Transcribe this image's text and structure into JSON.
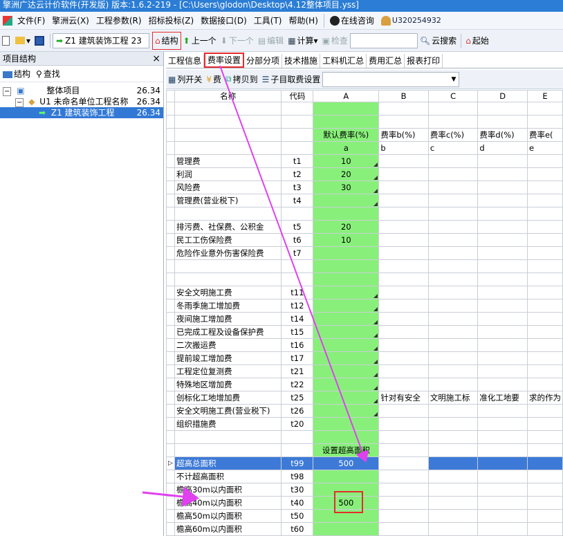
{
  "window": {
    "title": "擎洲广达云计价软件(开发版) 版本:1.6.2-219 - [C:\\Users\\glodon\\Desktop\\4.12整体项目.yss]"
  },
  "menu": [
    "文件(F)",
    "擎洲云(X)",
    "工程参数(R)",
    "招标投标(Z)",
    "数据接口(D)",
    "工具(T)",
    "帮助(H)",
    "在线咨询",
    "U320254932"
  ],
  "toolbar": {
    "project_combo": "Z1  建筑装饰工程 23",
    "structure": "结构",
    "prev": "上一个",
    "next": "下一个",
    "edit": "编辑",
    "calc": "计算",
    "check": "检查",
    "search_value": "",
    "cloud_search": "云搜索",
    "start": "起始"
  },
  "left_pane": {
    "title": "项目结构",
    "close": "×",
    "btn_structure": "结构",
    "btn_find": "查找",
    "tree": [
      {
        "label": "整体项目",
        "value": "26.34"
      },
      {
        "label": "U1   未命名单位工程名称",
        "value": "26.34"
      },
      {
        "label": "Z1   建筑装饰工程",
        "value": "26.34"
      }
    ]
  },
  "tabs": [
    "工程信息",
    "费率设置",
    "分部分项",
    "技术措施",
    "工料机汇总",
    "费用汇总",
    "报表打印"
  ],
  "sub_toolbar": {
    "col_toggle": "列开关",
    "fee": "费",
    "copy_to": "拷贝到",
    "sub_item_fee": "子目取费设置",
    "combo_value": ""
  },
  "grid": {
    "headers": [
      "名称",
      "代码",
      "A",
      "B",
      "C",
      "D",
      "E"
    ],
    "rows": [
      {
        "name": "",
        "code": "",
        "a": "",
        "b": "",
        "c": "",
        "d": "",
        "e": ""
      },
      {
        "name": "",
        "code": "",
        "a": "",
        "b": "",
        "c": "",
        "d": "",
        "e": ""
      },
      {
        "name": "",
        "code": "",
        "a": "默认费率(%)",
        "b": "费率b(%)",
        "c": "费率c(%)",
        "d": "费率d(%)",
        "e": "费率e("
      },
      {
        "name": "",
        "code": "",
        "a": "a",
        "b": "b",
        "c": "c",
        "d": "d",
        "e": "e"
      },
      {
        "name": "管理费",
        "code": "t1",
        "a": "10",
        "b": "",
        "c": "",
        "d": "",
        "e": ""
      },
      {
        "name": "利润",
        "code": "t2",
        "a": "20",
        "b": "",
        "c": "",
        "d": "",
        "e": ""
      },
      {
        "name": "风险费",
        "code": "t3",
        "a": "30",
        "b": "",
        "c": "",
        "d": "",
        "e": ""
      },
      {
        "name": "管理费(营业税下)",
        "code": "t4",
        "a": "",
        "b": "",
        "c": "",
        "d": "",
        "e": ""
      },
      {
        "name": "",
        "code": "",
        "a": "",
        "b": "",
        "c": "",
        "d": "",
        "e": ""
      },
      {
        "name": "排污费、社保费、公积金",
        "code": "t5",
        "a": "20",
        "b": "",
        "c": "",
        "d": "",
        "e": ""
      },
      {
        "name": "民工工伤保险费",
        "code": "t6",
        "a": "10",
        "b": "",
        "c": "",
        "d": "",
        "e": ""
      },
      {
        "name": "危险作业意外伤害保险费",
        "code": "t7",
        "a": "",
        "b": "",
        "c": "",
        "d": "",
        "e": ""
      },
      {
        "name": "",
        "code": "",
        "a": "",
        "b": "",
        "c": "",
        "d": "",
        "e": ""
      },
      {
        "name": "",
        "code": "",
        "a": "",
        "b": "",
        "c": "",
        "d": "",
        "e": ""
      },
      {
        "name": "安全文明施工费",
        "code": "t11",
        "a": "",
        "b": "",
        "c": "",
        "d": "",
        "e": ""
      },
      {
        "name": "冬雨季施工增加费",
        "code": "t12",
        "a": "",
        "b": "",
        "c": "",
        "d": "",
        "e": ""
      },
      {
        "name": "夜间施工增加费",
        "code": "t14",
        "a": "",
        "b": "",
        "c": "",
        "d": "",
        "e": ""
      },
      {
        "name": "已完成工程及设备保护费",
        "code": "t15",
        "a": "",
        "b": "",
        "c": "",
        "d": "",
        "e": ""
      },
      {
        "name": "二次搬运费",
        "code": "t16",
        "a": "",
        "b": "",
        "c": "",
        "d": "",
        "e": ""
      },
      {
        "name": "提前竣工增加费",
        "code": "t17",
        "a": "",
        "b": "",
        "c": "",
        "d": "",
        "e": ""
      },
      {
        "name": "工程定位复测费",
        "code": "t21",
        "a": "",
        "b": "",
        "c": "",
        "d": "",
        "e": ""
      },
      {
        "name": "特殊地区增加费",
        "code": "t22",
        "a": "",
        "b": "",
        "c": "",
        "d": "",
        "e": ""
      },
      {
        "name": "创标化工地增加费",
        "code": "t25",
        "a": "",
        "b": "针对有安全",
        "c": "文明施工标",
        "d": "准化工地要",
        "e": "求的作为"
      },
      {
        "name": "安全文明施工费(营业税下)",
        "code": "t26",
        "a": "",
        "b": "",
        "c": "",
        "d": "",
        "e": ""
      },
      {
        "name": "组织措施费",
        "code": "t20",
        "a": "",
        "b": "",
        "c": "",
        "d": "",
        "e": ""
      },
      {
        "name": "",
        "code": "",
        "a": "",
        "b": "",
        "c": "",
        "d": "",
        "e": ""
      },
      {
        "name": "",
        "code": "",
        "a": "设置超高面积",
        "b": "",
        "c": "",
        "d": "",
        "e": ""
      },
      {
        "name": "超高总面积",
        "code": "t99",
        "a": "500",
        "b": "",
        "c": "",
        "d": "",
        "e": ""
      },
      {
        "name": "不计超高面积",
        "code": "t98",
        "a": "",
        "b": "",
        "c": "",
        "d": "",
        "e": ""
      },
      {
        "name": "檐高30m以内面积",
        "code": "t30",
        "a": "",
        "b": "",
        "c": "",
        "d": "",
        "e": ""
      },
      {
        "name": "檐高40m以内面积",
        "code": "t40",
        "a": "500",
        "b": "",
        "c": "",
        "d": "",
        "e": ""
      },
      {
        "name": "檐高50m以内面积",
        "code": "t50",
        "a": "",
        "b": "",
        "c": "",
        "d": "",
        "e": ""
      },
      {
        "name": "檐高60m以内面积",
        "code": "t60",
        "a": "",
        "b": "",
        "c": "",
        "d": "",
        "e": ""
      }
    ]
  },
  "colors": {
    "accent": "#2b7dd5",
    "green_cell": "#88f07a",
    "selection": "#3d7ad8",
    "highlight_box": "#e52b2b",
    "arrow": "#e040f0"
  }
}
